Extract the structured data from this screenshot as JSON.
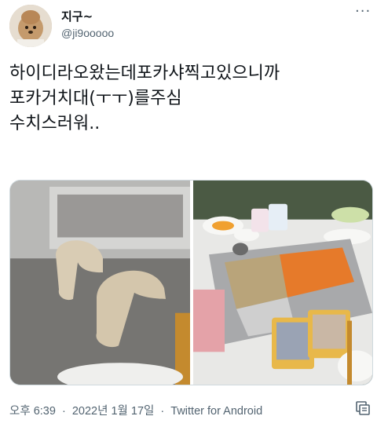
{
  "author": {
    "display_name": "지구~",
    "handle": "@ji9ooooo"
  },
  "tweet": {
    "text": "하이디라오왔는데포카샤찍고있으니까\n포카거치대(ㅜㅜ)를주심\n수치스러워.."
  },
  "meta": {
    "time": "오후 6:39",
    "separator": "·",
    "date": "2022년 1월 17일",
    "source": "Twitter for Android"
  },
  "icons": {
    "more": "more-icon",
    "translate": "translate-icon"
  }
}
